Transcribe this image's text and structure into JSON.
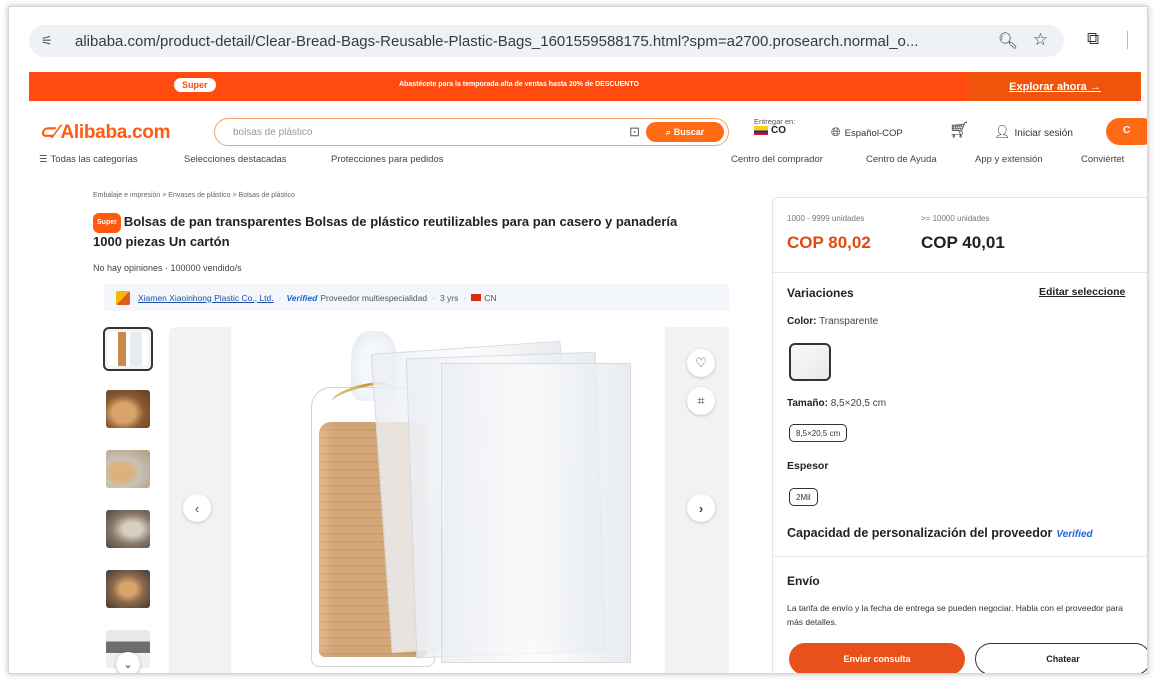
{
  "browser": {
    "url": "alibaba.com/product-detail/Clear-Bread-Bags-Reusable-Plastic-Bags_1601559588175.html?spm=a2700.prosearch.normal_o...",
    "site_settings_icon": "tune-icon",
    "zoom_icon": "zoom-icon",
    "bookmark_icon": "star-icon",
    "extensions_icon": "puzzle-icon"
  },
  "promo": {
    "badge": "Super",
    "text": "Abastécete para la temporada alta de ventas hasta 20% de DESCUENTO",
    "explore": "Explorar ahora →"
  },
  "header": {
    "logo": "Alibaba.com",
    "search_placeholder": "bolsas de plástico",
    "search_button": "Buscar",
    "deliver_label": "Entregar en:",
    "deliver_country": "CO",
    "language": "Español-COP",
    "login": "Iniciar sesión",
    "signup": "C"
  },
  "nav": {
    "left": [
      "Todas las categorías",
      "Selecciones destacadas",
      "Protecciones para pedidos"
    ],
    "right": [
      "Centro del comprador",
      "Centro de Ayuda",
      "App y extensión",
      "Conviértet"
    ]
  },
  "product": {
    "breadcrumb": "Embalaje e impresión  >  Envases de plástico  >  Bolsas de plástico",
    "title_badge": "Super",
    "title": "Bolsas de pan transparentes Bolsas de plástico reutilizables para pan casero y panadería 1000 piezas Un cartón",
    "reviews": "No hay opiniones · 100000 vendido/s",
    "supplier_name": "Xiamen Xiaoinhong Plastic Co., Ltd.",
    "verified": "Verified",
    "supplier_type": "Proveedor multiespecialidad",
    "years": "3 yrs",
    "country": "CN"
  },
  "pricing": {
    "tiers": [
      {
        "range": "1000 - 9999 unidades",
        "price": "COP 80,02"
      },
      {
        "range": ">= 10000 unidades",
        "price": "COP 40,01"
      }
    ]
  },
  "variations": {
    "title": "Variaciones",
    "edit": "Editar seleccione",
    "color_label": "Color:",
    "color_value": "Transparente",
    "size_label": "Tamaño:",
    "size_value": "8,5×20,5 cm",
    "size_chip": "8,5×20,5 cm",
    "thickness_label": "Espesor",
    "thickness_chip": "2Mil"
  },
  "customization": {
    "text": "Capacidad de personalización del proveedor",
    "verified": "Verified"
  },
  "shipping": {
    "title": "Envío",
    "text": "La tarifa de envío y la fecha de entrega se pueden negociar. Habla con el proveedor para más detalles."
  },
  "actions": {
    "inquiry": "Enviar consulta",
    "chat": "Chatear"
  }
}
